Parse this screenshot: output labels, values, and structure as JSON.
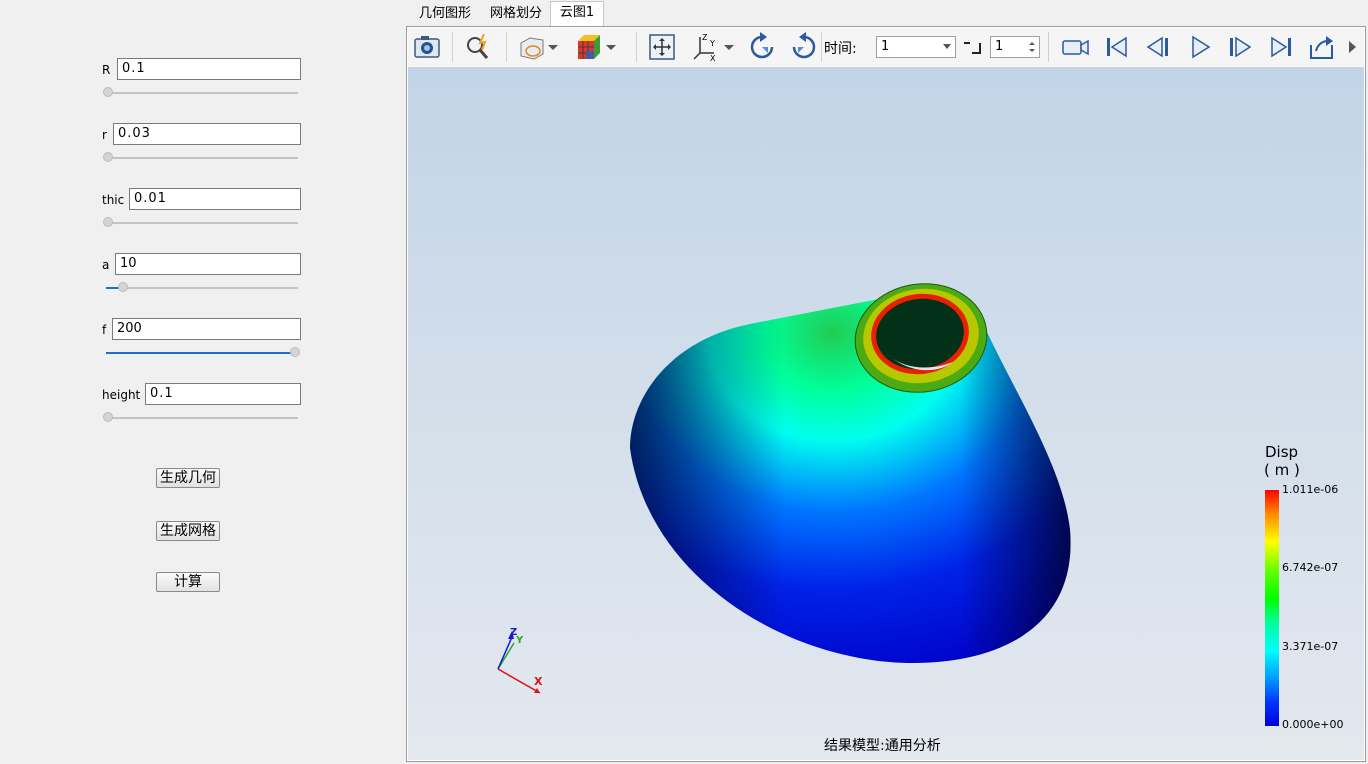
{
  "params": [
    {
      "label": "R",
      "value": "0.1",
      "fill": 0.0
    },
    {
      "label": "r",
      "value": "0.03",
      "fill": 0.0
    },
    {
      "label": "thic",
      "value": "0.01",
      "fill": 0.0
    },
    {
      "label": "a",
      "value": "10",
      "fill": 0.09
    },
    {
      "label": "f",
      "value": "200",
      "fill": 1.0
    },
    {
      "label": "height",
      "value": "0.1",
      "fill": 0.0
    }
  ],
  "buttons": {
    "gen_geometry": "生成几何",
    "gen_mesh": "生成网格",
    "compute": "计算"
  },
  "tabs": [
    "几何图形",
    "网格划分",
    "云图1"
  ],
  "active_tab": 2,
  "toolbar": {
    "time_label": "时间:",
    "time_value": "1",
    "step_value": "1",
    "icons": [
      "camera-icon",
      "zoom-icon",
      "display-mode-icon",
      "color-cube-icon",
      "fit-view-icon",
      "axes-icon",
      "rotate-cw-icon",
      "rotate-ccw-icon",
      "record-icon",
      "first-frame-icon",
      "prev-frame-icon",
      "play-icon",
      "next-frame-icon",
      "last-frame-icon",
      "export-icon"
    ]
  },
  "legend": {
    "title": "Disp",
    "unit": "( m )",
    "max": "1.011e-06",
    "mid_high": "6.742e-07",
    "mid_low": "3.371e-07",
    "min": "0.000e+00"
  },
  "triad": {
    "x": "X",
    "y": "Y",
    "z": "Z"
  },
  "caption": "结果模型:通用分析",
  "colors": {
    "accent": "#1f6fc5",
    "viewport_top": "#c2d4e8",
    "viewport_bottom": "#e4e8ef"
  }
}
